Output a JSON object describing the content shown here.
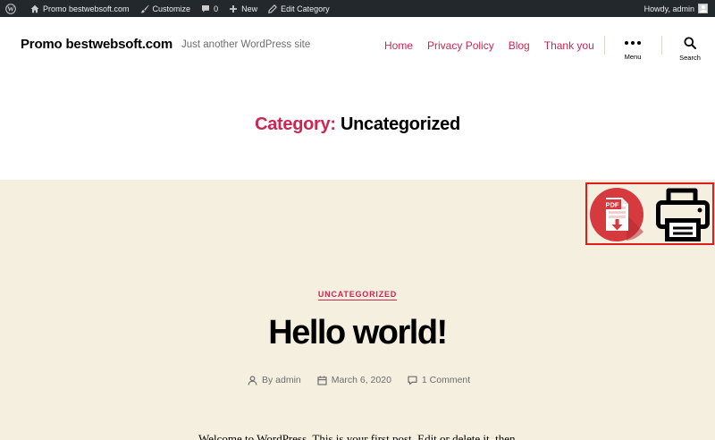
{
  "admin_bar": {
    "site_name": "Promo bestwebsoft.com",
    "customize": "Customize",
    "comments_count": "0",
    "new": "New",
    "edit_category": "Edit Category",
    "howdy": "Howdy, admin",
    "icons": [
      "wordpress-icon",
      "home-icon",
      "brush-icon",
      "comment-icon",
      "plus-icon",
      "pencil-icon",
      "avatar"
    ]
  },
  "header": {
    "site_title": "Promo bestwebsoft.com",
    "tagline": "Just another WordPress site",
    "nav": [
      "Home",
      "Privacy Policy",
      "Blog",
      "Thank you"
    ],
    "menu_label": "Menu",
    "search_label": "Search"
  },
  "archive": {
    "prefix": "Category:",
    "name": "Uncategorized"
  },
  "toolbar": {
    "pdf_label": "PDF",
    "icons": [
      "pdf-download-icon",
      "printer-icon"
    ]
  },
  "post": {
    "category": "UNCATEGORIZED",
    "title": "Hello world!",
    "author": "By admin",
    "date": "March 6, 2020",
    "comments": "1 Comment",
    "excerpt": "Welcome to WordPress. This is your first post. Edit or delete it, then"
  },
  "colors": {
    "accent": "#cd2653",
    "admin_bar": "#23282d",
    "content_bg": "#f5efe0",
    "highlight_border": "#e01b1b",
    "pdf_red": "#d63a3f"
  }
}
